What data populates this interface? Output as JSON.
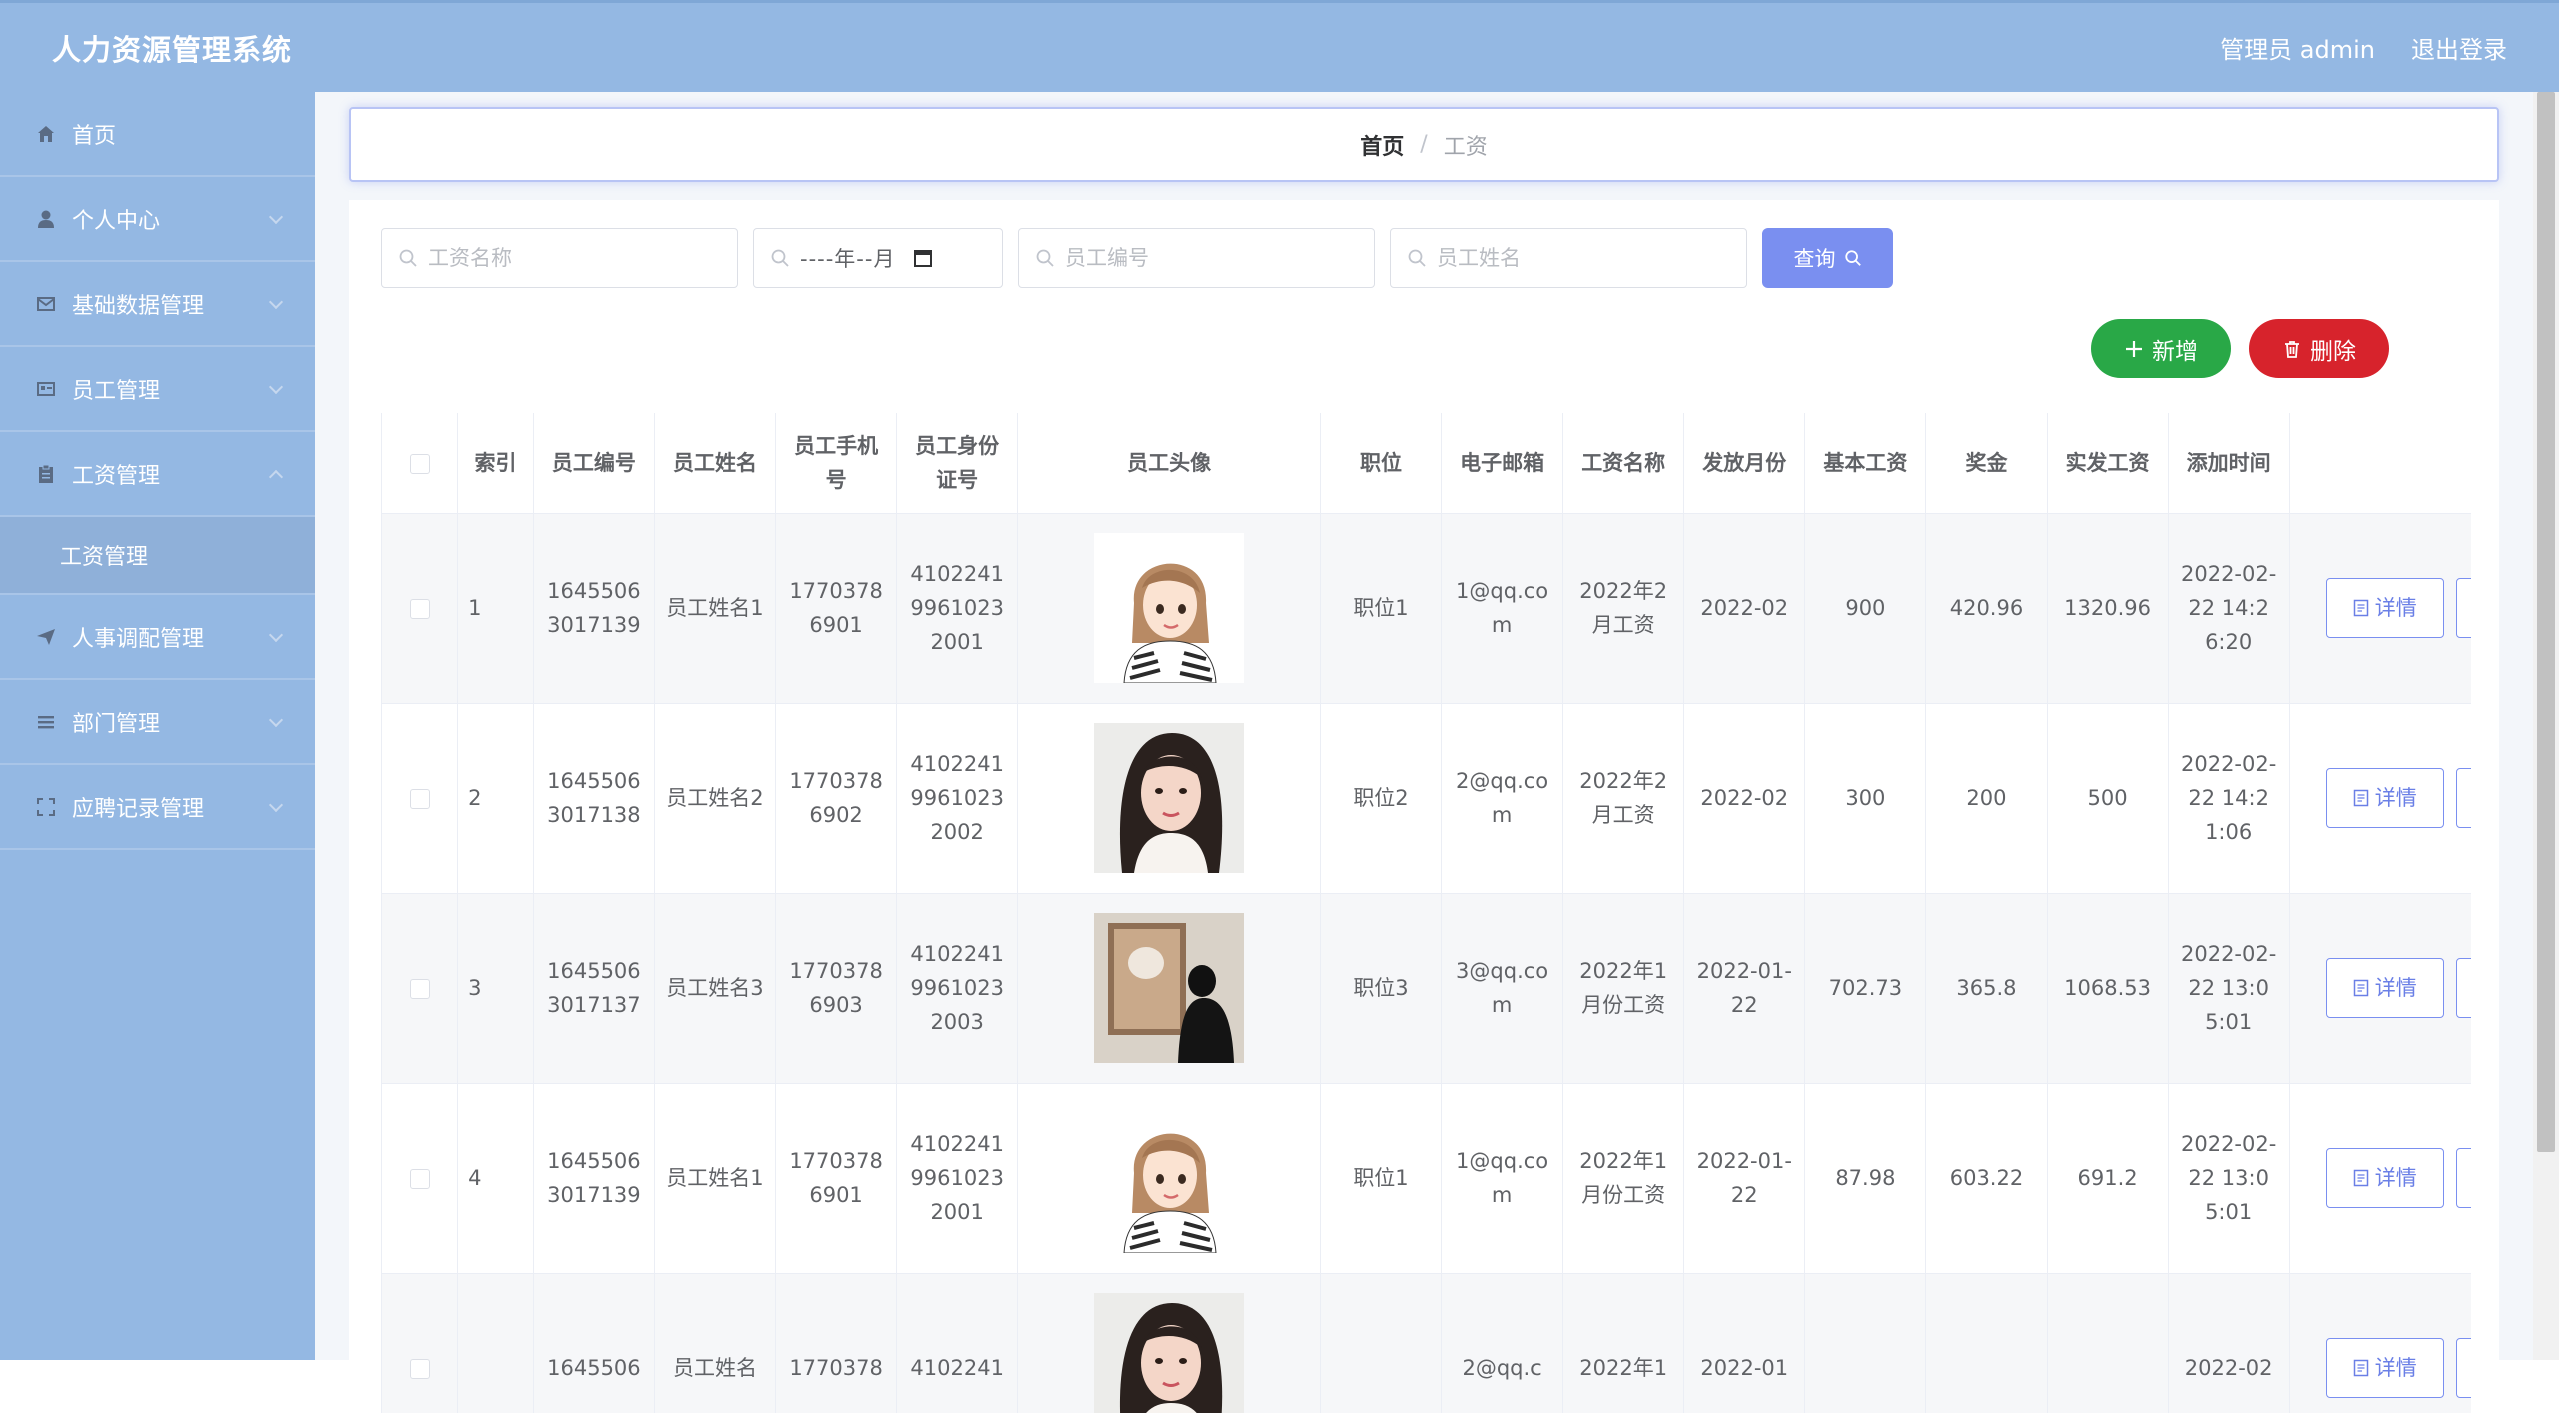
{
  "app": {
    "title": "人力资源管理系统"
  },
  "header": {
    "user": "管理员 admin",
    "logout": "退出登录"
  },
  "sidebar": {
    "items": [
      {
        "label": "首页",
        "icon": "home-icon"
      },
      {
        "label": "个人中心",
        "icon": "user-icon"
      },
      {
        "label": "基础数据管理",
        "icon": "mail-icon"
      },
      {
        "label": "员工管理",
        "icon": "id-card-icon"
      },
      {
        "label": "工资管理",
        "icon": "clipboard-icon"
      },
      {
        "label": "人事调配管理",
        "icon": "send-icon"
      },
      {
        "label": "部门管理",
        "icon": "menu-icon"
      },
      {
        "label": "应聘记录管理",
        "icon": "fullscreen-icon"
      }
    ],
    "submenu": {
      "label": "工资管理"
    }
  },
  "breadcrumb": {
    "home": "首页",
    "separator": "/",
    "current": "工资"
  },
  "search": {
    "salary_name_placeholder": "工资名称",
    "month_value": "----年--月",
    "employee_no_placeholder": "员工编号",
    "employee_name_placeholder": "员工姓名",
    "query_label": "查询"
  },
  "actions": {
    "add_label": "新增",
    "delete_label": "删除"
  },
  "table": {
    "headers": {
      "index": "索引",
      "employee_no": "员工编号",
      "employee_name": "员工姓名",
      "phone": "员工手机号",
      "id_card": "员工身份证号",
      "avatar": "员工头像",
      "position": "职位",
      "email": "电子邮箱",
      "salary_name": "工资名称",
      "month": "发放月份",
      "base": "基本工资",
      "bonus": "奖金",
      "actual": "实发工资",
      "created": "添加时间"
    },
    "detail_label": "详情",
    "rows": [
      {
        "index": "1",
        "employee_no": "16455063017139",
        "employee_name": "员工姓名1",
        "phone": "17703786901",
        "id_card": "410224199610232001",
        "avatar": "cartoon-woman",
        "position": "职位1",
        "email": "1@qq.com",
        "salary_name": "2022年2月工资",
        "month": "2022-02",
        "base": "900",
        "bonus": "420.96",
        "actual": "1320.96",
        "created": "2022-02-22 14:26:20"
      },
      {
        "index": "2",
        "employee_no": "16455063017138",
        "employee_name": "员工姓名2",
        "phone": "17703786902",
        "id_card": "410224199610232002",
        "avatar": "portrait-woman",
        "position": "职位2",
        "email": "2@qq.com",
        "salary_name": "2022年2月工资",
        "month": "2022-02",
        "base": "300",
        "bonus": "200",
        "actual": "500",
        "created": "2022-02-22 14:21:06"
      },
      {
        "index": "3",
        "employee_no": "16455063017137",
        "employee_name": "员工姓名3",
        "phone": "17703786903",
        "id_card": "410224199610232003",
        "avatar": "gallery-photo",
        "position": "职位3",
        "email": "3@qq.com",
        "salary_name": "2022年1月份工资",
        "month": "2022-01-22",
        "base": "702.73",
        "bonus": "365.8",
        "actual": "1068.53",
        "created": "2022-02-22 13:05:01"
      },
      {
        "index": "4",
        "employee_no": "16455063017139",
        "employee_name": "员工姓名1",
        "phone": "17703786901",
        "id_card": "410224199610232001",
        "avatar": "cartoon-woman",
        "position": "职位1",
        "email": "1@qq.com",
        "salary_name": "2022年1月份工资",
        "month": "2022-01-22",
        "base": "87.98",
        "bonus": "603.22",
        "actual": "691.2",
        "created": "2022-02-22 13:05:01"
      },
      {
        "index": "",
        "employee_no": "1645506",
        "employee_name": "员工姓名",
        "phone": "1770378",
        "id_card": "4102241",
        "avatar": "portrait-woman",
        "position": "",
        "email": "2@qq.c",
        "salary_name": "2022年1",
        "month": "2022-01",
        "base": "",
        "bonus": "",
        "actual": "",
        "created": "2022-02"
      }
    ]
  }
}
